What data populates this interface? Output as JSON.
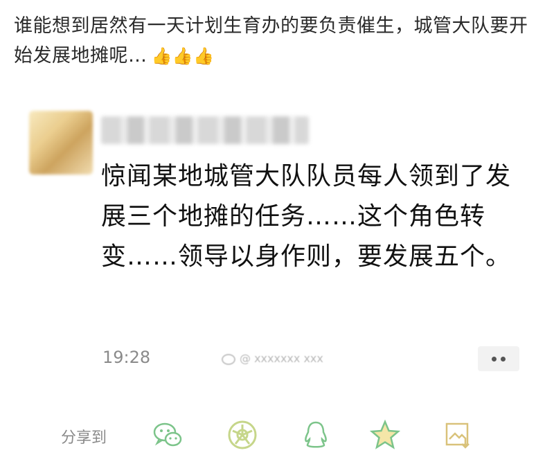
{
  "caption": {
    "text": "谁能想到居然有一天计划生育办的要负责催生，城管大队要开始发展地摊呢…",
    "emoji": "👍👍👍"
  },
  "post": {
    "text": "惊闻某地城管大队队员每人领到了发展三个地摊的任务……这个角色转变……领导以身作则，要发展五个。",
    "time": "19:28"
  },
  "share_bar": {
    "label": "分享到",
    "icons": [
      "wechat-icon",
      "moments-icon",
      "qq-icon",
      "qzone-star-icon",
      "image-save-icon"
    ],
    "accent_color": "#7cc48a"
  }
}
